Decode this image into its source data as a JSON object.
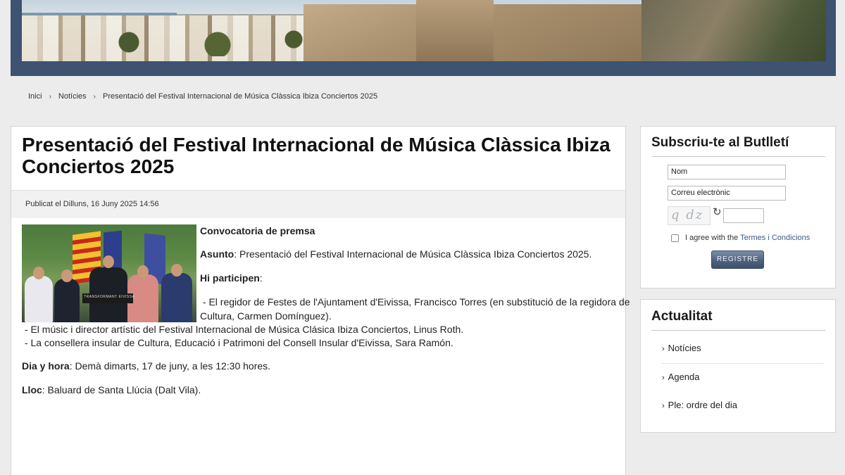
{
  "header": {
    "banner_alt": "Dalt Vila banner"
  },
  "breadcrumb": {
    "items": [
      "Inici",
      "Notícies",
      "Presentació del Festival Internacional de Música Clàssica Ibiza Conciertos 2025"
    ],
    "separator": "›"
  },
  "article": {
    "title": "Presentació del Festival Internacional de Música Clàssica Ibiza Conciertos 2025",
    "published": "Publicat el Dilluns, 16 Juny 2025 14:56",
    "photo_caption_text": "TRANSFORMANT EIVISSA",
    "heading": "Convocatoria de premsa",
    "subject_label": "Asunto",
    "subject_text": ": Presentació del Festival Internacional de Música Clàssica Ibiza Conciertos 2025.",
    "participants_label": "Hi participen",
    "participants_colon": ":",
    "participant_1a": " - El regidor de Festes de l'Ajuntament d'Eivissa, Francisco Torres (en substitució de la regidora de",
    "participant_1b": "Cultura, Carmen Domínguez).",
    "participant_2": " - El músic i director artístic del Festival Internacional de Música Clásica Ibiza Conciertos, Linus Roth.",
    "participant_3": " - La consellera insular de Cultura, Educació i Patrimoni del Consell Insular d'Eivissa, Sara Ramón.",
    "date_label": "Dia y hora",
    "date_text": ": Demà dimarts, 17 de juny, a les 12:30 hores.",
    "place_label": "Lloc",
    "place_text": ": Baluard de Santa Llúcia (Dalt Vila)."
  },
  "newsletter": {
    "title": "Subscriu-te al Butlletí",
    "name_placeholder": "Nom",
    "email_placeholder": "Correu electrònic",
    "captcha_text": "q dz",
    "agree_text": "I agree with the",
    "terms_link": "Termes i Condicions",
    "submit_label": "REGISTRE"
  },
  "news": {
    "title": "Actualitat",
    "items": [
      "Notícies",
      "Agenda",
      "Ple: ordre del dia"
    ]
  }
}
